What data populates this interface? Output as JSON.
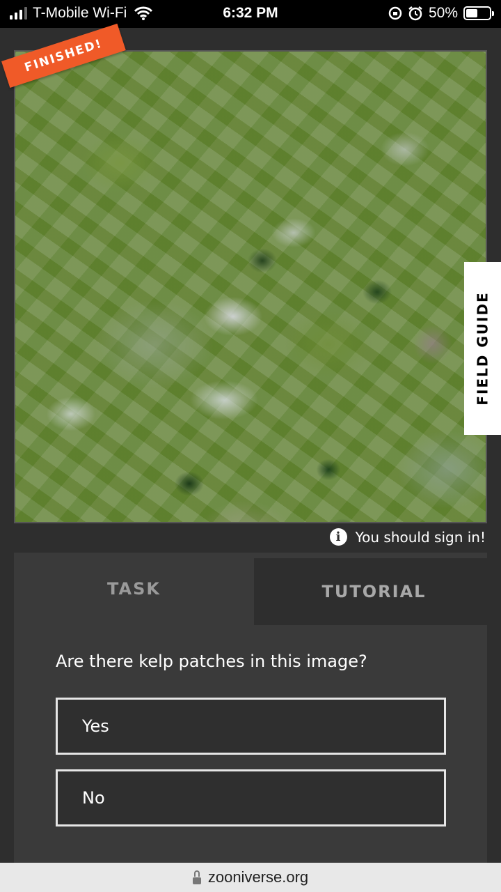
{
  "status_bar": {
    "carrier": "T-Mobile Wi-Fi",
    "time": "6:32 PM",
    "battery_percent": "50%",
    "battery_level": 0.5,
    "icons": [
      "signal-icon",
      "wifi-icon",
      "rotation-lock-icon",
      "alarm-icon",
      "battery-icon"
    ]
  },
  "subject": {
    "finished_label": "FINISHED!",
    "field_guide_label": "FIELD GUIDE"
  },
  "signin": {
    "message": "You should sign in!"
  },
  "tabs": {
    "task_label": "TASK",
    "tutorial_label": "TUTORIAL"
  },
  "task": {
    "question": "Are there kelp patches in this image?",
    "answers": [
      "Yes",
      "No"
    ]
  },
  "browser": {
    "url": "zooniverse.org"
  },
  "colors": {
    "accent": "#f05a28",
    "background": "#2e2e2e",
    "panel": "#3a3a3a"
  }
}
